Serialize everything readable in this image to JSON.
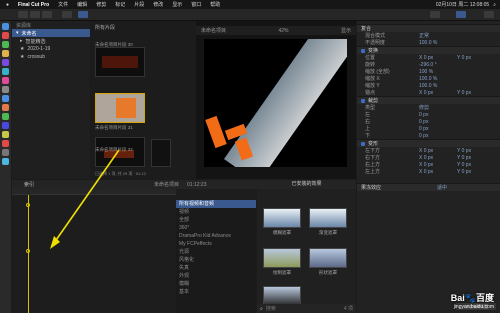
{
  "menubar": {
    "app_name": "Final Cut Pro",
    "items": [
      "文件",
      "编辑",
      "修剪",
      "标记",
      "片段",
      "修改",
      "显示",
      "窗口",
      "帮助"
    ],
    "clock": "02月10日 周二 12:08:05"
  },
  "library": {
    "title": "资源库",
    "items": [
      {
        "label": "未命名"
      },
      {
        "label": "智能精选"
      },
      {
        "label": "2020-1-19"
      },
      {
        "label": "crossub"
      }
    ]
  },
  "browser": {
    "filter_label": "所有片段",
    "clips": [
      {
        "label": "未命名项目片段 30"
      },
      {
        "label": "未命名项目片段 31"
      },
      {
        "label": "未命名项目片段 32"
      }
    ],
    "status": "已选择 1 项, 共 29 项 · 01:12"
  },
  "viewer": {
    "title": "未命名项目",
    "zoom": "42%",
    "display_label": "显示"
  },
  "inspector": {
    "sections": [
      {
        "title": "复合",
        "params": [
          {
            "name": "混合模式",
            "v": "正常"
          },
          {
            "name": "不透明度",
            "v": "100.0 %"
          }
        ]
      },
      {
        "title": "变换",
        "params": [
          {
            "name": "位置",
            "v": "X  0 px",
            "v2": "Y  0 px"
          },
          {
            "name": "旋转",
            "v": "-296.0 °"
          },
          {
            "name": "缩放 (全部)",
            "v": "100 %"
          },
          {
            "name": "缩放 X",
            "v": "100.0 %"
          },
          {
            "name": "缩放 Y",
            "v": "100.0 %"
          },
          {
            "name": "锚点",
            "v": "X  0 px",
            "v2": "Y  0 px"
          }
        ]
      },
      {
        "title": "裁剪",
        "params": [
          {
            "name": "类型",
            "v": "修剪"
          },
          {
            "name": "左",
            "v": "0 px"
          },
          {
            "name": "右",
            "v": "0 px"
          },
          {
            "name": "上",
            "v": "0 px"
          },
          {
            "name": "下",
            "v": "0 px"
          }
        ]
      },
      {
        "title": "变形",
        "params": [
          {
            "name": "左下方",
            "v": "X  0 px",
            "v2": "Y  0 px"
          },
          {
            "name": "右下方",
            "v": "X  0 px",
            "v2": "Y  0 px"
          },
          {
            "name": "右上方",
            "v": "X  0 px",
            "v2": "Y  0 px"
          },
          {
            "name": "左上方",
            "v": "X  0 px",
            "v2": "Y  0 px"
          }
        ]
      }
    ],
    "stabilization": {
      "title": "果冻效应",
      "value": "适中"
    },
    "save_button": "存储效果预置"
  },
  "timeline": {
    "index_label": "索引",
    "project": "未命名项目",
    "timecode": "01:12:23"
  },
  "effects": {
    "header": "已安装的效果",
    "categories": [
      "所有视频和音频",
      "视频",
      "全部",
      "360°",
      "DramaPro Kid Advance",
      "My FCPeffects",
      "光源",
      "风格化",
      "失真",
      "外观",
      "模糊",
      "基本"
    ],
    "items": [
      {
        "label": "模糊遮罩"
      },
      {
        "label": "渐变遮罩"
      },
      {
        "label": "绘制遮罩"
      },
      {
        "label": "形状遮罩"
      }
    ],
    "search_placeholder": "搜索",
    "count": "4 项"
  },
  "watermark": {
    "main": "Bai🐾百度",
    "sub": "jingyan.baidu.com"
  },
  "colors": {
    "accent": "#3a5a8f",
    "arrow": "#f0e000",
    "orange": "#f26b16"
  }
}
